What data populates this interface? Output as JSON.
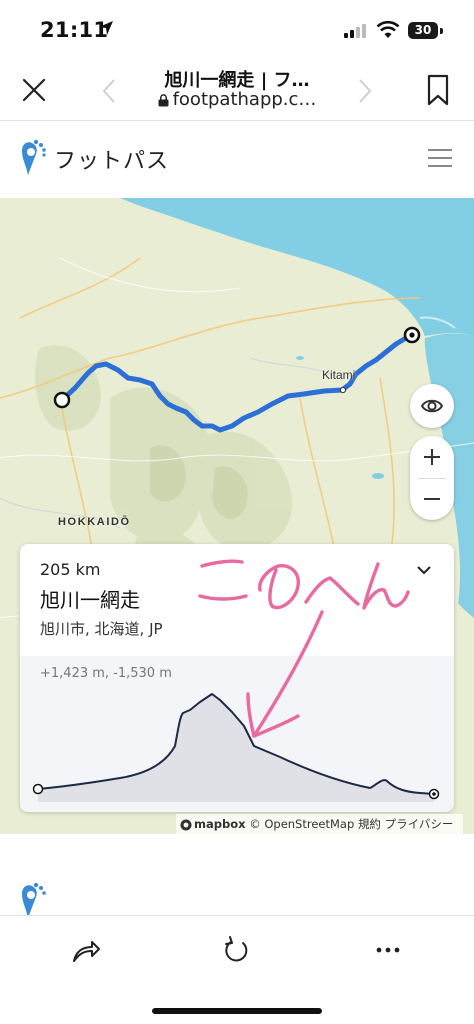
{
  "status_bar": {
    "time": "21:11",
    "battery": "30"
  },
  "browser": {
    "title": "旭川一網走 | フ…",
    "url": "footpathapp.c…"
  },
  "site": {
    "logo_text": "フットパス"
  },
  "map": {
    "labels": {
      "city": "Kitami",
      "region": "HOKKAIDŌ"
    },
    "attribution": {
      "brand": "mapbox",
      "osm": "© OpenStreetMap",
      "terms": "規約",
      "privacy": "プライバシー"
    }
  },
  "route": {
    "distance": "205 km",
    "name": "旭川一網走",
    "location": "旭川市, 北海道, JP",
    "elevation_stats": "+1,423 m, -1,530 m"
  },
  "annotation": {
    "handwritten_text": "このへん"
  },
  "colors": {
    "route_line": "#2c6fd6",
    "sea": "#7fcfe6",
    "land": "#e7ecd3",
    "annotation": "#e86aa0",
    "elevation_fill": "#dfe1e6",
    "elevation_line": "#1c2a44"
  },
  "icons": {
    "close": "close-icon",
    "back": "chevron-left-icon",
    "forward": "chevron-right-icon",
    "bookmark": "bookmark-icon",
    "menu": "hamburger-menu-icon",
    "eye": "eye-icon",
    "zoom_in": "plus-icon",
    "zoom_out": "minus-icon",
    "collapse": "chevron-down-icon",
    "share": "share-icon",
    "reload": "reload-icon",
    "more": "more-icon"
  }
}
